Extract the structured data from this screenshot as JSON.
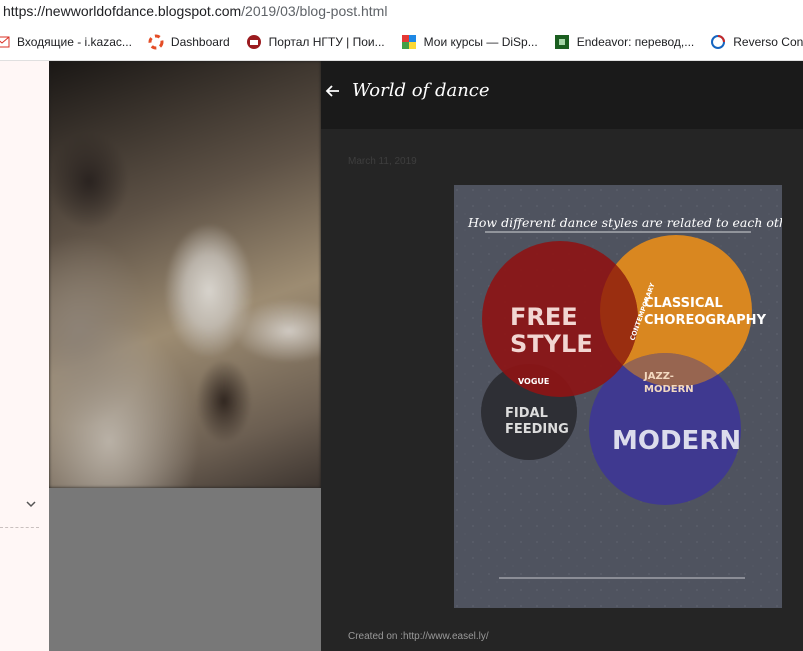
{
  "browser": {
    "url_host": "https://newworldofdance.blogspot.com",
    "url_path": "/2019/03/blog-post.html",
    "bookmarks": [
      {
        "label": "Входящие - i.kazac...",
        "icon": "mail-icon"
      },
      {
        "label": "Dashboard",
        "icon": "lifebuoy-icon"
      },
      {
        "label": "Портал НГТУ | Пои...",
        "icon": "university-icon"
      },
      {
        "label": "Мои курсы — DiSp...",
        "icon": "courses-icon"
      },
      {
        "label": "Endeavor: перевод,...",
        "icon": "endeavor-icon"
      },
      {
        "label": "Reverso Context",
        "icon": "reverso-icon"
      }
    ]
  },
  "blog": {
    "title": "World of dance",
    "date": "March 11, 2019",
    "credit": "Created on :http://www.easel.ly/"
  },
  "infographic": {
    "heading": "How different dance styles are related to each other?",
    "circles": {
      "free_style": [
        "FREE",
        "STYLE"
      ],
      "classical": [
        "CLASSICAL",
        "CHOREOGRAPHY"
      ],
      "modern": "MODERN",
      "fidal": [
        "FIDAL",
        "FEEDING"
      ],
      "contemporary": "CONTEMPORARY",
      "vogue": "VOGUE",
      "jazz": [
        "JAZZ-",
        "MODERN"
      ]
    },
    "colors": {
      "free_style": "#8c1416",
      "classical": "#e08a1c",
      "modern": "#3f3990",
      "fidal": "#2e2f35",
      "background": "#4f535f"
    }
  }
}
